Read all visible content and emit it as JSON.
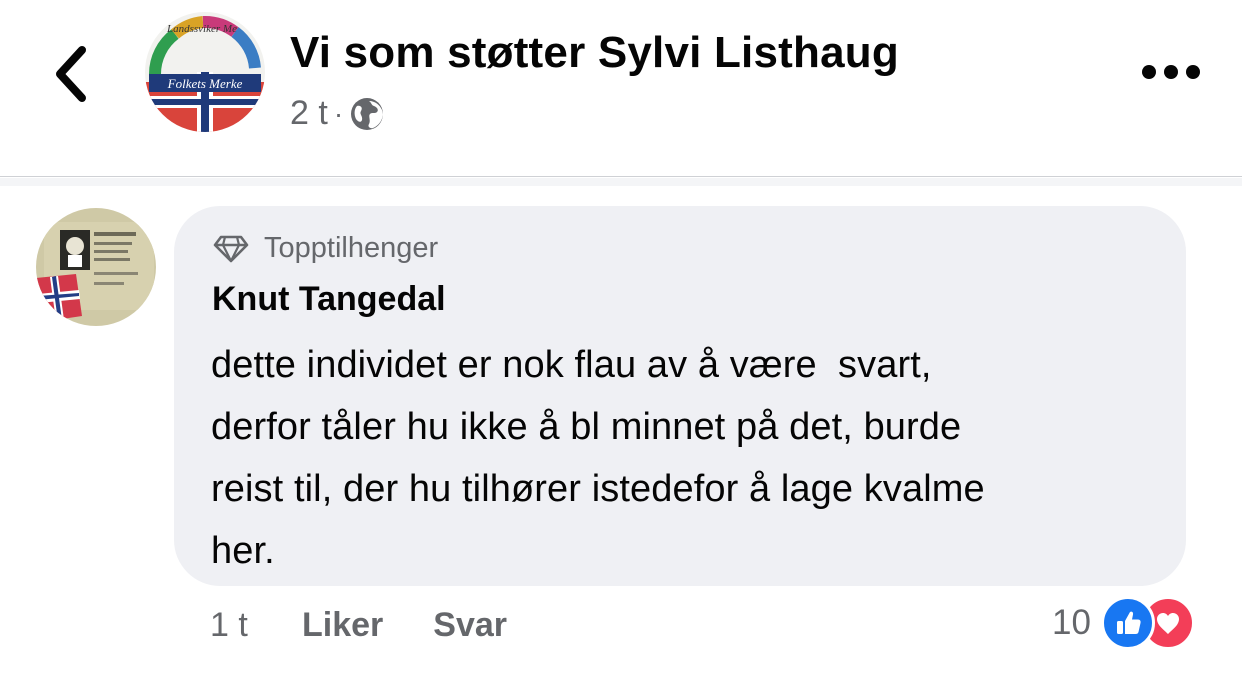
{
  "header": {
    "group_name": "Vi som støtter Sylvi Listhaug",
    "time": "2 t",
    "separator": "·",
    "visibility_icon": "globe-icon",
    "avatar_text_top": "Landssviker Me",
    "avatar_text_bottom": "Folkets Merke"
  },
  "comment": {
    "badge_icon": "diamond-icon",
    "badge_label": "Topptilhenger",
    "author": "Knut Tangedal",
    "text": "dette individet er nok flau av å være  svart,\nderfor tåler hu ikke å bl minnet på det, burde\nreist til, der hu tilhører istedefor å lage kvalme\nher.",
    "time": "1 t",
    "like_label": "Liker",
    "reply_label": "Svar",
    "reaction_count": "10",
    "reactions": [
      "like-icon",
      "love-icon"
    ]
  },
  "colors": {
    "text_primary": "#050505",
    "text_secondary": "#65676b",
    "bubble_bg": "#eff0f4",
    "like_blue": "#1877f2",
    "love_red": "#f33e58"
  }
}
